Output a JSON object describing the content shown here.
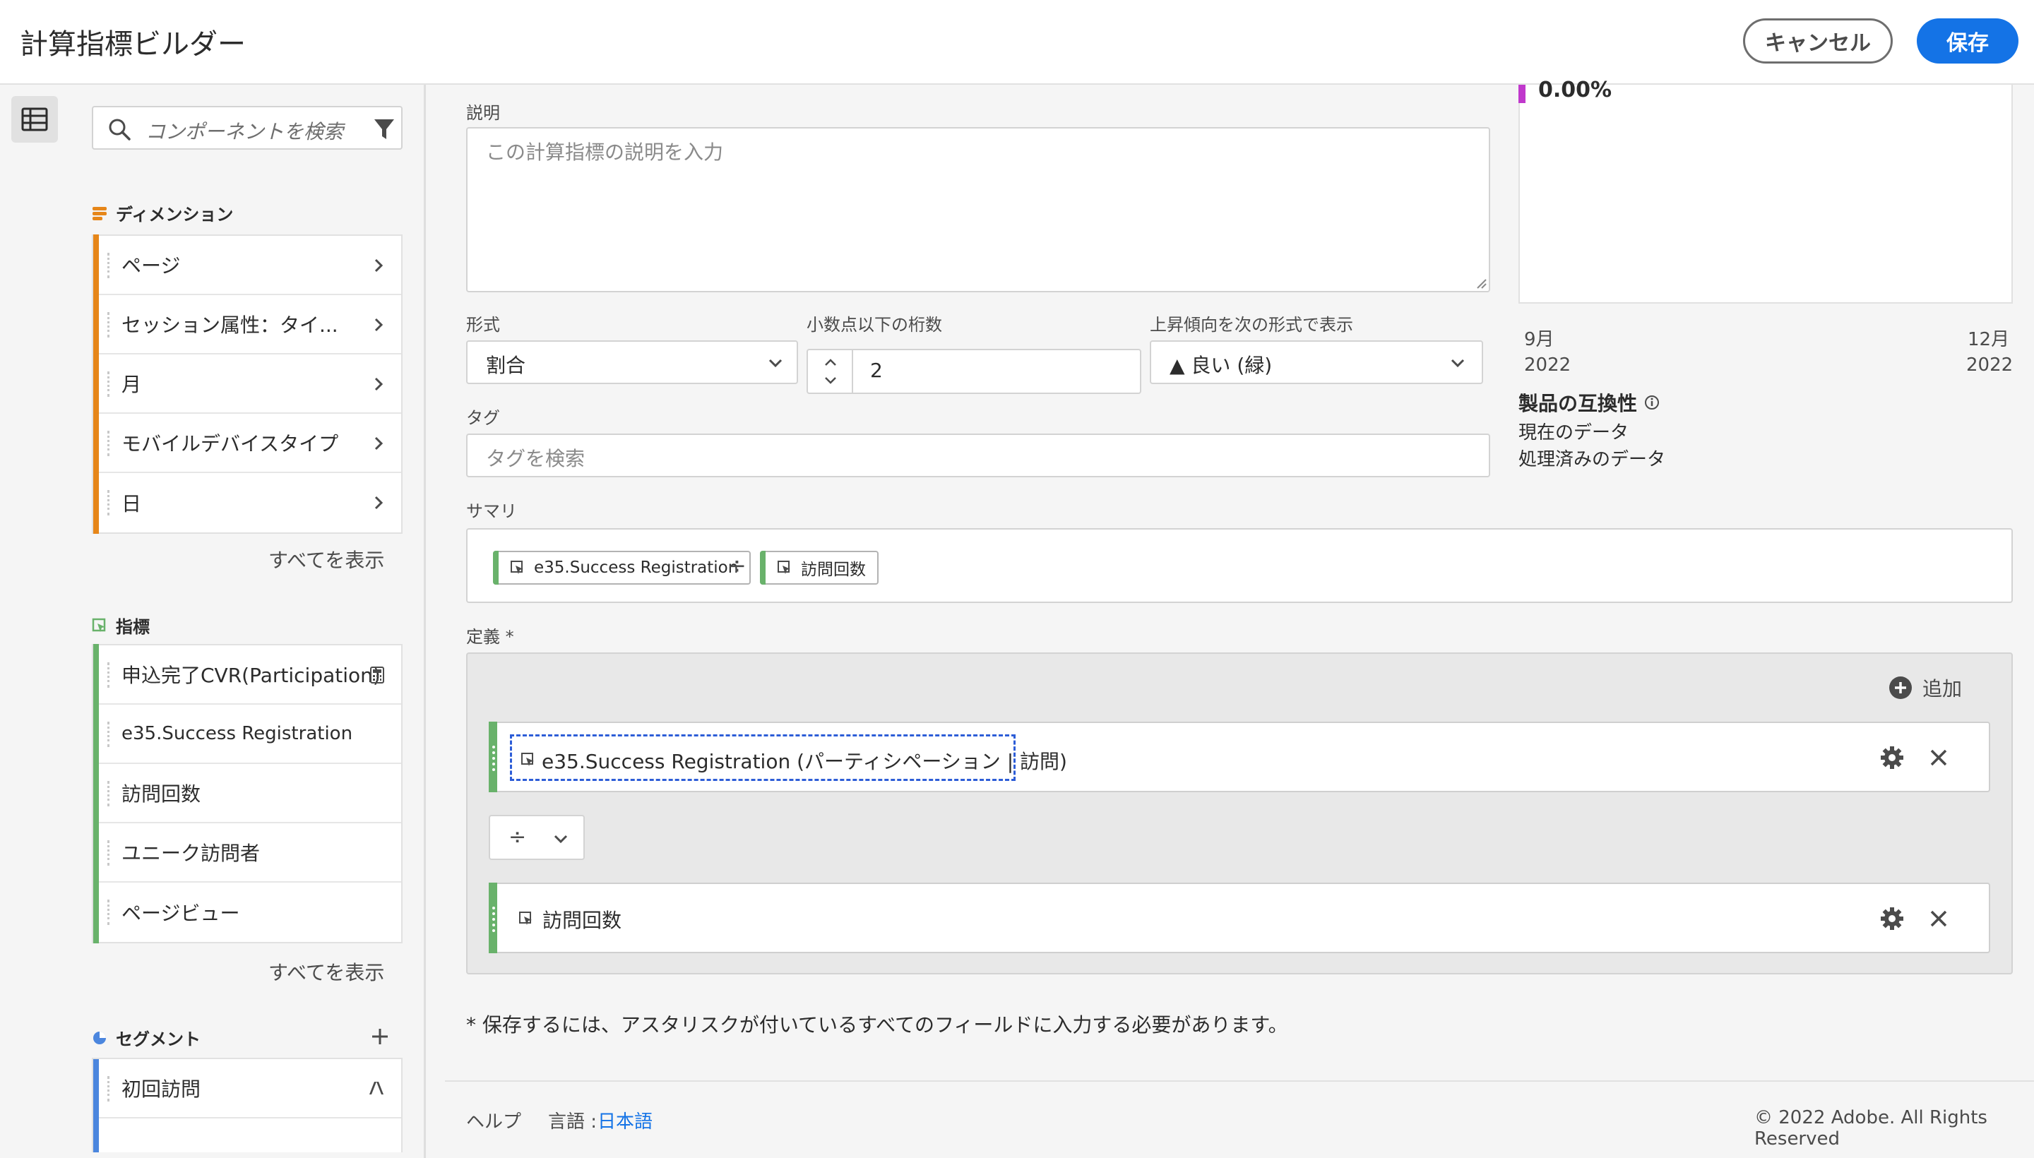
{
  "header": {
    "title": "計算指標ビルダー",
    "cancel_label": "キャンセル",
    "save_label": "保存"
  },
  "panel": {
    "search_placeholder": "コンポーネントを検索",
    "dimensions": {
      "heading": "ディメンション",
      "color": "#e68619",
      "items": [
        "ページ",
        "セッション属性：タイ...",
        "月",
        "モバイルデバイスタイプ",
        "日"
      ],
      "show_all": "すべてを表示"
    },
    "metrics": {
      "heading": "指標",
      "color": "#69b26b",
      "items": [
        "申込完了CVR(Participation)",
        "e35.Success Registration",
        "訪問回数",
        "ユニーク訪問者",
        "ページビュー"
      ],
      "show_all": "すべてを表示"
    },
    "segments": {
      "heading": "セグメント",
      "color": "#4b86de",
      "items": [
        "初回訪問"
      ]
    }
  },
  "form": {
    "description_label": "説明",
    "description_placeholder": "この計算指標の説明を入力",
    "format_label": "形式",
    "format_value": "割合",
    "decimals_label": "小数点以下の桁数",
    "decimals_value": "2",
    "trend_label": "上昇傾向を次の形式で表示",
    "trend_value": "▲ 良い (緑)",
    "tags_label": "タグ",
    "tags_placeholder": "タグを検索",
    "summary_label": "サマリ",
    "summary_chips": [
      "e35.Success Registration",
      "訪問回数"
    ],
    "summary_operator": "÷",
    "definition_label": "定義 *",
    "add_label": "追加",
    "definition_rows": [
      "e35.Success Registration (パーティシペーション | 訪問)",
      "訪問回数"
    ],
    "operator": "÷",
    "required_note": "* 保存するには、アスタリスクが付いているすべてのフィールドに入力する必要があります。"
  },
  "preview": {
    "value": "0.00%",
    "accent_color": "#c038cc",
    "x_start_month": "9月",
    "x_start_year": "2022",
    "x_end_month": "12月",
    "x_end_year": "2022",
    "compat_heading": "製品の互換性",
    "compat_items": [
      "現在のデータ",
      "処理済みのデータ"
    ]
  },
  "footer": {
    "help": "ヘルプ",
    "language_label": "言語 :",
    "language_value": "日本語",
    "copyright": "© 2022 Adobe. All Rights Reserved"
  }
}
